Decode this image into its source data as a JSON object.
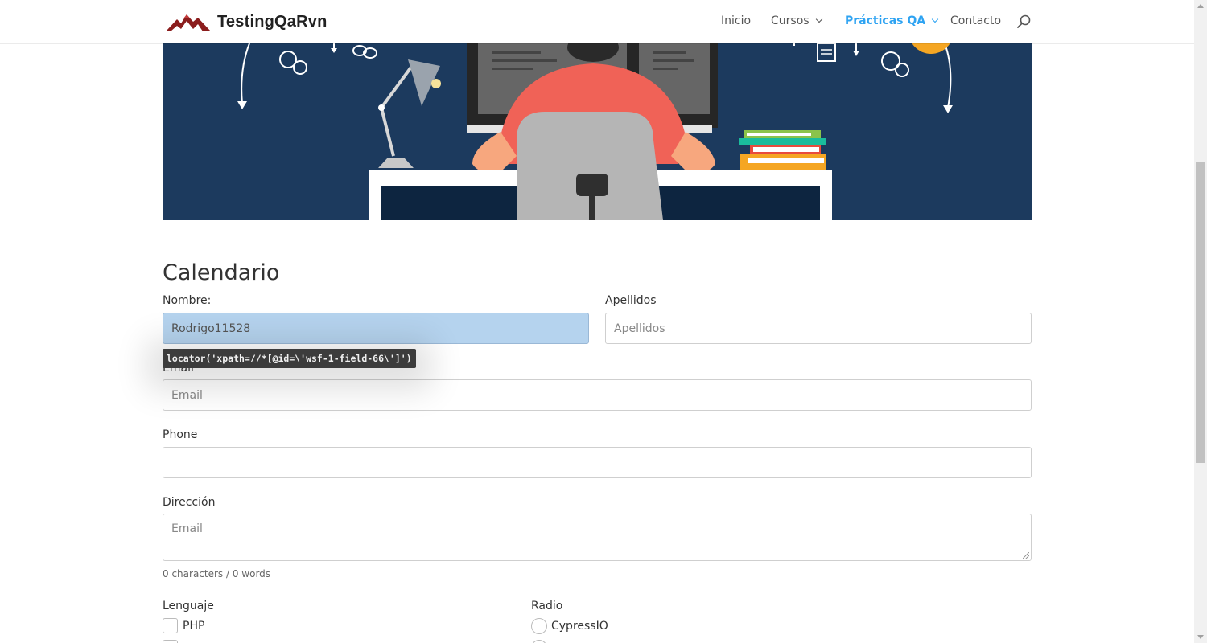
{
  "header": {
    "logo_text": "TestingQaRvn",
    "nav": [
      {
        "label": "Inicio",
        "dropdown": false,
        "active": false
      },
      {
        "label": "Cursos",
        "dropdown": true,
        "active": false
      },
      {
        "label": "Prácticas QA",
        "dropdown": true,
        "active": true
      },
      {
        "label": "Contacto",
        "dropdown": false,
        "active": false
      }
    ],
    "search_icon": "search-icon"
  },
  "colors": {
    "accent": "#2ea3f2",
    "hero_bg": "#1c3a5e",
    "focused_field_bg": "#b5d3ee"
  },
  "form": {
    "title": "Calendario",
    "nombre": {
      "label": "Nombre:",
      "value": "Rodrigo11528"
    },
    "apellidos": {
      "label": "Apellidos",
      "placeholder": "Apellidos"
    },
    "email": {
      "label": "Email",
      "placeholder": "Email"
    },
    "phone": {
      "label": "Phone",
      "placeholder": ""
    },
    "direccion": {
      "label": "Dirección",
      "placeholder": "Email",
      "counter": "0 characters / 0 words"
    },
    "lenguaje": {
      "label": "Lenguaje",
      "options": [
        "PHP"
      ]
    },
    "radio": {
      "label": "Radio",
      "options": [
        "CypressIO"
      ]
    }
  },
  "tooltip": "locator('xpath=//*[@id=\\'wsf-1-field-66\\']')"
}
